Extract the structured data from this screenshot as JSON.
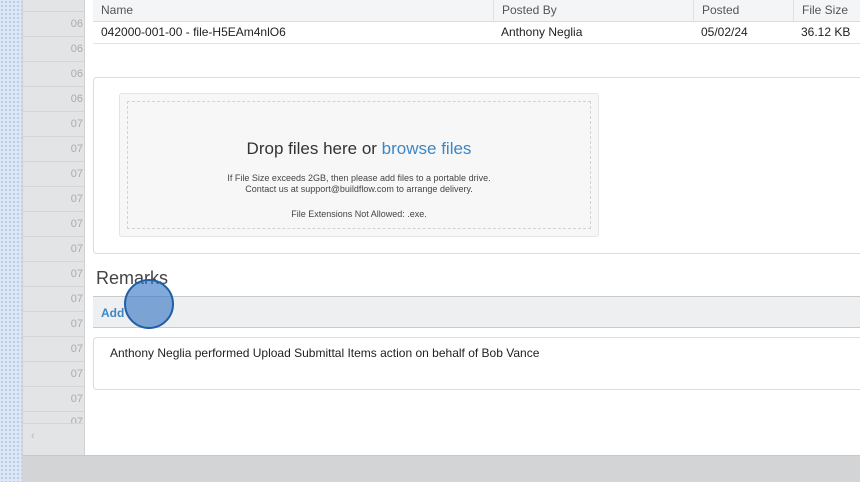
{
  "background_list": {
    "row_labels": [
      "06",
      "06",
      "06",
      "06",
      "07",
      "07",
      "07",
      "07",
      "07",
      "07",
      "07",
      "07",
      "07",
      "07",
      "07",
      "07",
      "07"
    ],
    "scroll_arrow": "‹"
  },
  "files_table": {
    "headers": [
      "Name",
      "Posted By",
      "Posted",
      "File Size"
    ],
    "rows": [
      {
        "name": "042000-001-00 - file-H5EAm4nlO6",
        "posted_by": "Anthony Neglia",
        "posted": "05/02/24",
        "file_size": "36.12 KB"
      }
    ]
  },
  "upload": {
    "drop_text": "Drop files here or",
    "browse_text": "browse files",
    "size_note_line1": "If File Size exceeds 2GB, then please add files to a portable drive.",
    "size_note_line2": "Contact us at support@buildflow.com to arrange delivery.",
    "extensions_note": "File Extensions Not Allowed: .exe."
  },
  "remarks": {
    "title": "Remarks",
    "add_label": "Add",
    "entries": [
      "Anthony Neglia performed Upload Submittal Items action on behalf of Bob Vance"
    ]
  },
  "colors": {
    "link": "#3c87c4",
    "click_indicator": "#3476c4"
  }
}
